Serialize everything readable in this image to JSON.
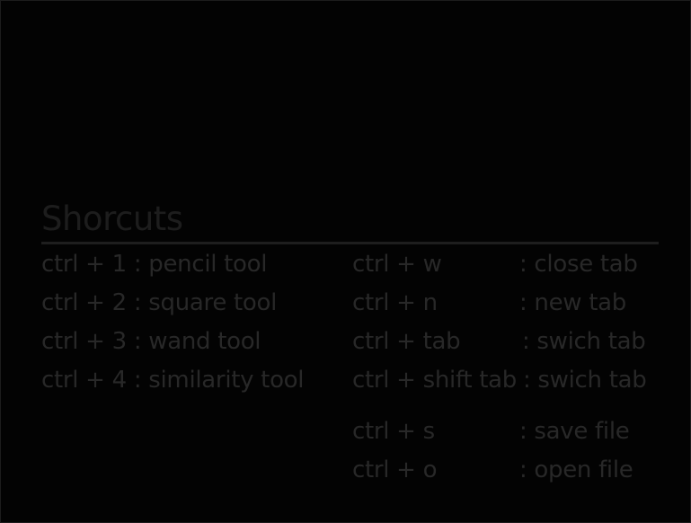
{
  "title": "Shorcuts",
  "tools": [
    {
      "shortcut": "ctrl + 1 : pencil tool"
    },
    {
      "shortcut": "ctrl + 2 : square tool"
    },
    {
      "shortcut": "ctrl + 3 : wand tool"
    },
    {
      "shortcut": "ctrl + 4 : similarity tool"
    }
  ],
  "tabs": [
    {
      "keys": "ctrl + w",
      "action": ": close tab"
    },
    {
      "keys": "ctrl + n",
      "action": ": new tab"
    },
    {
      "keys": "ctrl + tab",
      "action": ": swich tab"
    },
    {
      "keys": "ctrl + shift tab",
      "action": ": swich tab"
    }
  ],
  "files": [
    {
      "keys": "ctrl + s",
      "action": ": save file"
    },
    {
      "keys": "ctrl + o",
      "action": ": open file"
    }
  ],
  "colors": {
    "background": "#030303",
    "title": "#1d1d1d",
    "text": "#282828",
    "divider": "#1e1e1e"
  }
}
